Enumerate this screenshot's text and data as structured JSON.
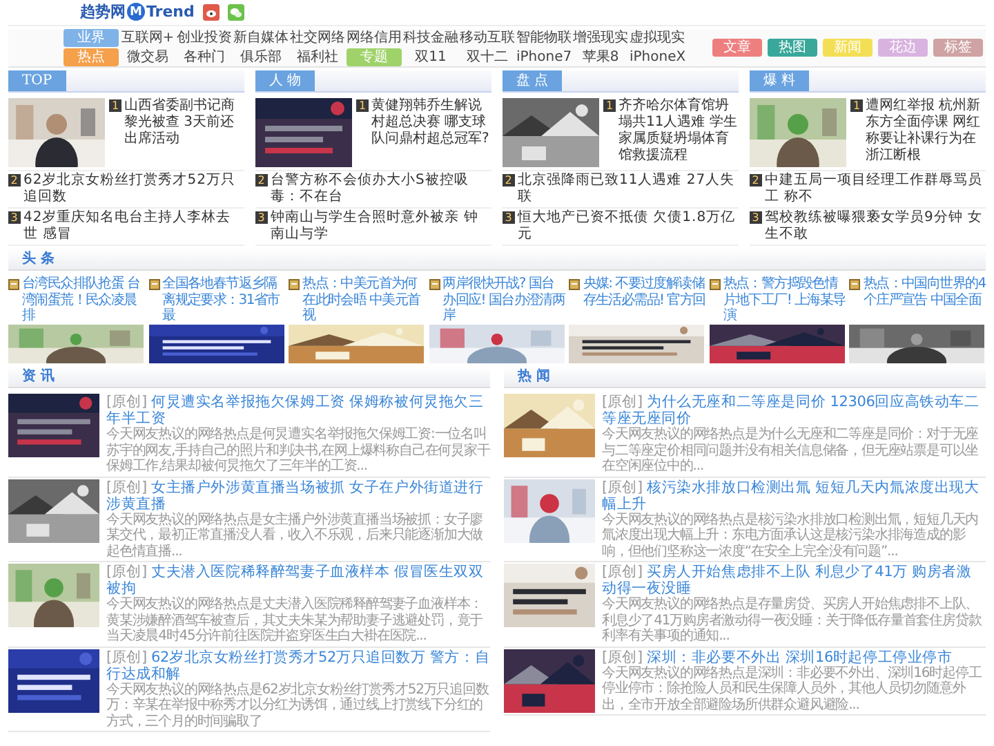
{
  "logo": {
    "name": "趋势网",
    "mark": "M",
    "brand": "Trend"
  },
  "nav": {
    "rows": [
      [
        {
          "label": "业界",
          "color": "#7fb3e8"
        },
        {
          "label": "互联网+"
        },
        {
          "label": "创业投资"
        },
        {
          "label": "新自媒体"
        },
        {
          "label": "社交网络"
        },
        {
          "label": "网络信用"
        },
        {
          "label": "科技金融"
        },
        {
          "label": "移动互联"
        },
        {
          "label": "智能物联"
        },
        {
          "label": "增强现实"
        },
        {
          "label": "虚拟现实"
        }
      ],
      [
        {
          "label": "热点",
          "color": "#f5a04a"
        },
        {
          "label": "微交易"
        },
        {
          "label": "各种门"
        },
        {
          "label": "俱乐部"
        },
        {
          "label": "福利社"
        },
        {
          "label": "专题",
          "color": "#9fd36a"
        },
        {
          "label": "双11"
        },
        {
          "label": "双十二"
        },
        {
          "label": "iPhone7"
        },
        {
          "label": "苹果8"
        },
        {
          "label": "iPhoneX"
        }
      ]
    ],
    "quick_links": [
      {
        "label": "文章",
        "color": "#ee7f7f"
      },
      {
        "label": "热图",
        "color": "#3aa79b"
      },
      {
        "label": "新闻",
        "color": "#f3df55"
      },
      {
        "label": "花边",
        "color": "#d9b3e0"
      },
      {
        "label": "标签",
        "color": "#cfa3a3"
      }
    ]
  },
  "columns": [
    {
      "title": "TOP",
      "lead": {
        "rank": "1",
        "text": "山西省委副书记商黎光被查 3天前还出席活动"
      },
      "items": [
        {
          "rank": "2",
          "text": "62岁北京女粉丝打赏秀才52万只追回数"
        },
        {
          "rank": "3",
          "text": "42岁重庆知名电台主持人李林去世 感冒"
        }
      ]
    },
    {
      "title": "人 物",
      "lead": {
        "rank": "1",
        "text": "黄健翔韩乔生解说村超总决赛 哪支球队问鼎村超总冠军?"
      },
      "items": [
        {
          "rank": "2",
          "text": "台警方称不会侦办大小S被控吸毒：不在台"
        },
        {
          "rank": "3",
          "text": "钟南山与学生合照时意外被亲 钟南山与学"
        }
      ]
    },
    {
      "title": "盘 点",
      "lead": {
        "rank": "1",
        "text": "齐齐哈尔体育馆坍塌共11人遇难 学生家属质疑坍塌体育馆救援流程"
      },
      "items": [
        {
          "rank": "2",
          "text": "北京强降雨已致11人遇难 27人失联"
        },
        {
          "rank": "3",
          "text": "恒大地产已资不抵债 欠债1.8万亿元"
        }
      ]
    },
    {
      "title": "爆 料",
      "lead": {
        "rank": "1",
        "text": "遭网红举报 杭州新东方全面停课 网红称要让补课行为在浙江断根"
      },
      "items": [
        {
          "rank": "2",
          "text": "中建五局一项目经理工作群辱骂员工 称不"
        },
        {
          "rank": "3",
          "text": "驾校教练被曝猥亵女学员9分钟 女生不敢"
        }
      ]
    }
  ],
  "headlines": {
    "title": "头 条",
    "items": [
      {
        "text": "台湾民众排队抢蛋 台湾闹蛋荒！民众凌晨排"
      },
      {
        "text": "全国各地春节返乡隔离规定要求：31省市最"
      },
      {
        "text": "热点：中美元首为何在此时会晤 中美元首视"
      },
      {
        "text": "两岸很快开战? 国台办回应! 国台办澄清两岸"
      },
      {
        "text": "央媒: 不要过度解读储存生活必需品! 官方回"
      },
      {
        "text": "热点：警方捣毁色情片地下工厂! 上海某导演"
      },
      {
        "text": "热点：中国向世界的4个庄严宣告 中国全面"
      }
    ]
  },
  "news_sections": [
    {
      "title": "资 讯",
      "items": [
        {
          "tag": "[原创]",
          "title": "何炅遭实名举报拖欠保姆工资 保姆称被何炅拖欠三年半工资",
          "summary": "今天网友热议的网络热点是何炅遭实名举报拖欠保姆工资:一位名叫苏宇的网友,手持自己的照片和判决书,在网上爆料称自己在何炅家干保姆工作,结果却被何炅拖欠了三年半的工资..."
        },
        {
          "tag": "[原创]",
          "title": "女主播户外涉黄直播当场被抓 女子在户外街道进行涉黄直播",
          "summary": "今天网友热议的网络热点是女主播户外涉黄直播当场被抓：女子廖某交代，最初正常直播没人看，收入不乐观，后来只能逐渐加大做起色情直播..."
        },
        {
          "tag": "[原创]",
          "title": "丈夫潜入医院稀释醉驾妻子血液样本 假冒医生双双被拘",
          "summary": "今天网友热议的网络热点是丈夫潜入医院稀释醉驾妻子血液样本：黄某涉嫌醉酒驾车被查后，其丈夫朱某为帮助妻子逃避处罚，竟于当天凌晨4时45分许前往医院并盗穿医生白大褂在医院..."
        },
        {
          "tag": "[原创]",
          "title": "62岁北京女粉丝打赏秀才52万只追回数万 警方：自行达成和解",
          "summary": "今天网友热议的网络热点是62岁北京女粉丝打赏秀才52万只追回数万：辛某在举报中称秀才以分红为诱饵，通过线上打赏线下分红的方式，三个月的时间骗取了"
        }
      ]
    },
    {
      "title": "热 闻",
      "items": [
        {
          "tag": "[原创]",
          "title": "为什么无座和二等座是同价 12306回应高铁动车二等座无座同价",
          "summary": "今天网友热议的网络热点是为什么无座和二等座是同价：对于无座与二等座定价相同问题并没有相关信息储备，但无座站票是可以坐在空闲座位中的..."
        },
        {
          "tag": "[原创]",
          "title": "核污染水排放口检测出氚 短短几天内氚浓度出现大幅上升",
          "summary": "今天网友热议的网络热点是核污染水排放口检测出氚，短短几天内氚浓度出现大幅上升：东电方面承认这是核污染水排海造成的影响，但他们坚称这一浓度“在安全上完全没有问题”..."
        },
        {
          "tag": "[原创]",
          "title": "买房人开始焦虑排不上队 利息少了41万 购房者激动得一夜没睡",
          "summary": "今天网友热议的网络热点是存量房贷、买房人开始焦虑排不上队、利息少了41万购房者激动得一夜没睡：关于降低存量首套住房贷款利率有关事项的通知..."
        },
        {
          "tag": "[原创]",
          "title": "深圳：非必要不外出 深圳16时起停工停业停市",
          "summary": "今天网友热议的网络热点是深圳：非必要不外出、深圳16时起停工停业停市：除抢险人员和民生保障人员外，其他人员切勿随意外出，全市开放全部避险场所供群众避风避险..."
        }
      ]
    }
  ]
}
